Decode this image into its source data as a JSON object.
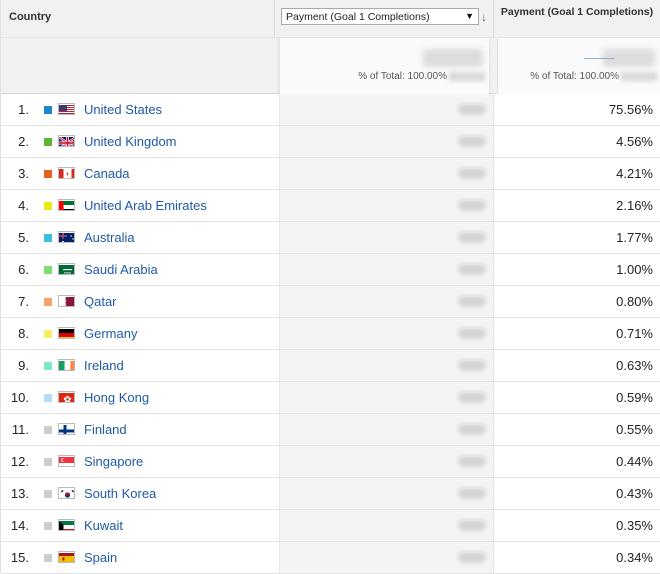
{
  "header": {
    "country_label": "Country",
    "metric_select_value": "Payment (Goal 1 Completions)",
    "percent_column_title": "Payment (Goal 1 Completions)"
  },
  "totals": {
    "metric_pct_label": "% of Total: 100.00%",
    "percent_pct_label": "% of Total: 100.00%"
  },
  "rows": [
    {
      "rank": "1.",
      "country": "United States",
      "percent": "75.56%",
      "swatch": "#1a88c9",
      "flag": "us"
    },
    {
      "rank": "2.",
      "country": "United Kingdom",
      "percent": "4.56%",
      "swatch": "#5cb531",
      "flag": "gb"
    },
    {
      "rank": "3.",
      "country": "Canada",
      "percent": "4.21%",
      "swatch": "#e8621f",
      "flag": "ca"
    },
    {
      "rank": "4.",
      "country": "United Arab Emirates",
      "percent": "2.16%",
      "swatch": "#eaea12",
      "flag": "ae"
    },
    {
      "rank": "5.",
      "country": "Australia",
      "percent": "1.77%",
      "swatch": "#3cc0de",
      "flag": "au"
    },
    {
      "rank": "6.",
      "country": "Saudi Arabia",
      "percent": "1.00%",
      "swatch": "#7ee06c",
      "flag": "sa"
    },
    {
      "rank": "7.",
      "country": "Qatar",
      "percent": "0.80%",
      "swatch": "#f4a267",
      "flag": "qa"
    },
    {
      "rank": "8.",
      "country": "Germany",
      "percent": "0.71%",
      "swatch": "#f7ef6a",
      "flag": "de"
    },
    {
      "rank": "9.",
      "country": "Ireland",
      "percent": "0.63%",
      "swatch": "#7ce8c6",
      "flag": "ie"
    },
    {
      "rank": "10.",
      "country": "Hong Kong",
      "percent": "0.59%",
      "swatch": "#b9daf6",
      "flag": "hk"
    },
    {
      "rank": "11.",
      "country": "Finland",
      "percent": "0.55%",
      "swatch": "#cccccc",
      "flag": "fi"
    },
    {
      "rank": "12.",
      "country": "Singapore",
      "percent": "0.44%",
      "swatch": "#cccccc",
      "flag": "sg"
    },
    {
      "rank": "13.",
      "country": "South Korea",
      "percent": "0.43%",
      "swatch": "#cccccc",
      "flag": "kr"
    },
    {
      "rank": "14.",
      "country": "Kuwait",
      "percent": "0.35%",
      "swatch": "#cccccc",
      "flag": "kw"
    },
    {
      "rank": "15.",
      "country": "Spain",
      "percent": "0.34%",
      "swatch": "#cccccc",
      "flag": "es"
    }
  ]
}
